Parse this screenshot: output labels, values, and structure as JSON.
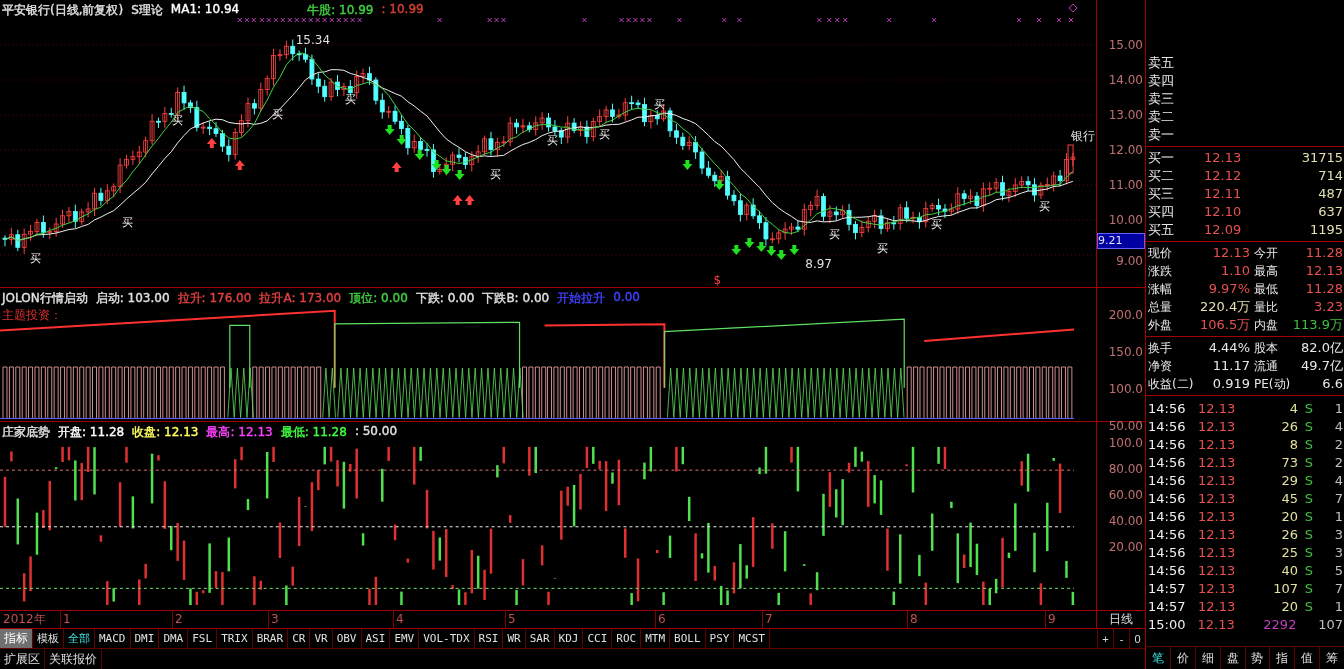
{
  "main_chart": {
    "header": [
      {
        "text": "平安银行(日线,前复权)",
        "color": "#e0e0e0"
      },
      {
        "text": "S理论",
        "color": "#e0e0e0"
      },
      {
        "text": "MA1: 10.94",
        "color": "#ffffff"
      },
      {
        "text": "牛股: 10.99",
        "color": "#40d040"
      },
      {
        "text": ": 10.99",
        "color": "#d04030"
      }
    ],
    "annotations": [
      {
        "kind": "high",
        "text": "15.34"
      },
      {
        "kind": "low",
        "text": "8.97"
      },
      {
        "kind": "name",
        "text": "银行"
      },
      {
        "kind": "signal",
        "text": "$"
      }
    ],
    "buy_labels": [
      "买",
      "买",
      "买",
      "买",
      "买",
      "买",
      "买",
      "买",
      "买",
      "买",
      "买",
      "买",
      "买"
    ],
    "axis": [
      "15.00",
      "14.00",
      "13.00",
      "12.00",
      "11.00",
      "10.00"
    ],
    "axis_last": "9.00",
    "current_price": "9.21"
  },
  "indicator_panel": {
    "header": [
      {
        "text": "JOLON行情启动",
        "color": "#e0e0e0"
      },
      {
        "text": "启动: 103.00",
        "color": "#e0e0e0"
      },
      {
        "text": "拉升: 176.00",
        "color": "#e04040"
      },
      {
        "text": "拉升A: 173.00",
        "color": "#e04040"
      },
      {
        "text": "顶位: 0.00",
        "color": "#40d040"
      },
      {
        "text": "下跌: 0.00",
        "color": "#e0e0e0"
      },
      {
        "text": "下跌B: 0.00",
        "color": "#e0e0e0"
      },
      {
        "text": "开始拉升",
        "color": "#4040ff"
      },
      {
        "text": "0.00",
        "color": "#4040ff"
      }
    ],
    "label": "主题投资：",
    "axis": [
      "200.0",
      "150.0",
      "100.0",
      "50.00"
    ]
  },
  "oscillator_panel": {
    "header": [
      {
        "text": "庄家底势",
        "color": "#e0e0e0"
      },
      {
        "text": "开盘: 11.28",
        "color": "#ffffff"
      },
      {
        "text": "收盘: 12.13",
        "color": "#ffff60"
      },
      {
        "text": "最高: 12.13",
        "color": "#ff40ff"
      },
      {
        "text": "最低: 11.28",
        "color": "#40ff40"
      },
      {
        "text": ": 50.00",
        "color": "#e0e0e0"
      }
    ],
    "axis": [
      "100.0",
      "80.00",
      "60.00",
      "40.00",
      "20.00"
    ]
  },
  "date_axis": {
    "year": "2012年",
    "months": [
      "1",
      "2",
      "3",
      "4",
      "5",
      "6",
      "7",
      "8",
      "9"
    ],
    "period": "日线"
  },
  "zoom_buttons": [
    "+",
    "-",
    "0"
  ],
  "indicator_tabs": [
    {
      "label": "指标",
      "selected": false,
      "kind": "header"
    },
    {
      "label": "模板",
      "selected": false,
      "kind": "item"
    },
    {
      "label": "全部",
      "selected": true,
      "kind": "item"
    },
    {
      "label": "MACD",
      "selected": false,
      "kind": "item"
    },
    {
      "label": "DMI",
      "selected": false,
      "kind": "item"
    },
    {
      "label": "DMA",
      "selected": false,
      "kind": "item"
    },
    {
      "label": "FSL",
      "selected": false,
      "kind": "item"
    },
    {
      "label": "TRIX",
      "selected": false,
      "kind": "item"
    },
    {
      "label": "BRAR",
      "selected": false,
      "kind": "item"
    },
    {
      "label": "CR",
      "selected": false,
      "kind": "item"
    },
    {
      "label": "VR",
      "selected": false,
      "kind": "item"
    },
    {
      "label": "OBV",
      "selected": false,
      "kind": "item"
    },
    {
      "label": "ASI",
      "selected": false,
      "kind": "item"
    },
    {
      "label": "EMV",
      "selected": false,
      "kind": "item"
    },
    {
      "label": "VOL-TDX",
      "selected": false,
      "kind": "item"
    },
    {
      "label": "RSI",
      "selected": false,
      "kind": "item"
    },
    {
      "label": "WR",
      "selected": false,
      "kind": "item"
    },
    {
      "label": "SAR",
      "selected": false,
      "kind": "item"
    },
    {
      "label": "KDJ",
      "selected": false,
      "kind": "item"
    },
    {
      "label": "CCI",
      "selected": false,
      "kind": "item"
    },
    {
      "label": "ROC",
      "selected": false,
      "kind": "item"
    },
    {
      "label": "MTM",
      "selected": false,
      "kind": "item"
    },
    {
      "label": "BOLL",
      "selected": false,
      "kind": "item"
    },
    {
      "label": "PSY",
      "selected": false,
      "kind": "item"
    },
    {
      "label": "MCST",
      "selected": false,
      "kind": "item"
    }
  ],
  "extension_tabs": [
    "扩展区",
    "关联报价"
  ],
  "quote": {
    "sell": [
      "卖五",
      "卖四",
      "卖三",
      "卖二",
      "卖一"
    ],
    "buy": [
      {
        "label": "买一",
        "price": "12.13",
        "volume": "31715"
      },
      {
        "label": "买二",
        "price": "12.12",
        "volume": "714"
      },
      {
        "label": "买三",
        "price": "12.11",
        "volume": "487"
      },
      {
        "label": "买四",
        "price": "12.10",
        "volume": "637"
      },
      {
        "label": "买五",
        "price": "12.09",
        "volume": "1195"
      }
    ],
    "stats": [
      {
        "cells": [
          {
            "label": "现价",
            "value": "12.13",
            "color": "#e85050"
          },
          {
            "label": "今开",
            "value": "11.28",
            "color": "#e85050"
          }
        ]
      },
      {
        "cells": [
          {
            "label": "涨跌",
            "value": "1.10",
            "color": "#e85050"
          },
          {
            "label": "最高",
            "value": "12.13",
            "color": "#e85050"
          }
        ]
      },
      {
        "cells": [
          {
            "label": "涨幅",
            "value": "9.97%",
            "color": "#e85050"
          },
          {
            "label": "最低",
            "value": "11.28",
            "color": "#e85050"
          }
        ]
      },
      {
        "cells": [
          {
            "label": "总量",
            "value": "220.4万",
            "color": "#e0e0b0"
          },
          {
            "label": "量比",
            "value": "3.23",
            "color": "#e85050"
          }
        ]
      },
      {
        "cells": [
          {
            "label": "外盘",
            "value": "106.5万",
            "color": "#e85050"
          },
          {
            "label": "内盘",
            "value": "113.9万",
            "color": "#40c040"
          }
        ]
      }
    ],
    "fundamentals": [
      {
        "label": "换手",
        "value": "4.44%",
        "label2": "股本",
        "value2": "82.0亿"
      },
      {
        "label": "净资",
        "value": "11.17",
        "label2": "流通",
        "value2": "49.7亿"
      },
      {
        "label": "收益(二)",
        "value": "0.919",
        "label2": "PE(动)",
        "value2": "6.6"
      }
    ],
    "trades": [
      {
        "kind": "trade",
        "time": "14:56",
        "price": "12.13",
        "volume": "4",
        "side": "S",
        "count": "1"
      },
      {
        "kind": "trade",
        "time": "14:56",
        "price": "12.13",
        "volume": "26",
        "side": "S",
        "count": "4"
      },
      {
        "kind": "trade",
        "time": "14:56",
        "price": "12.13",
        "volume": "8",
        "side": "S",
        "count": "2"
      },
      {
        "kind": "trade",
        "time": "14:56",
        "price": "12.13",
        "volume": "73",
        "side": "S",
        "count": "2"
      },
      {
        "kind": "trade",
        "time": "14:56",
        "price": "12.13",
        "volume": "29",
        "side": "S",
        "count": "4"
      },
      {
        "kind": "trade",
        "time": "14:56",
        "price": "12.13",
        "volume": "45",
        "side": "S",
        "count": "7"
      },
      {
        "kind": "trade",
        "time": "14:56",
        "price": "12.13",
        "volume": "20",
        "side": "S",
        "count": "1"
      },
      {
        "kind": "trade",
        "time": "14:56",
        "price": "12.13",
        "volume": "26",
        "side": "S",
        "count": "3"
      },
      {
        "kind": "trade",
        "time": "14:56",
        "price": "12.13",
        "volume": "25",
        "side": "S",
        "count": "3"
      },
      {
        "kind": "trade",
        "time": "14:56",
        "price": "12.13",
        "volume": "40",
        "side": "S",
        "count": "5"
      },
      {
        "kind": "trade",
        "time": "14:57",
        "price": "12.13",
        "volume": "107",
        "side": "S",
        "count": "7"
      },
      {
        "kind": "trade",
        "time": "14:57",
        "price": "12.13",
        "volume": "20",
        "side": "S",
        "count": "1"
      },
      {
        "kind": "summary",
        "time": "15:00",
        "price": "12.13",
        "volume": "2292",
        "count": "107"
      }
    ],
    "tabs": [
      {
        "label": "笔",
        "selected": true
      },
      {
        "label": "价",
        "selected": false
      },
      {
        "label": "细",
        "selected": false
      },
      {
        "label": "盘",
        "selected": false
      },
      {
        "label": "势",
        "selected": false
      },
      {
        "label": "指",
        "selected": false
      },
      {
        "label": "值",
        "selected": false
      },
      {
        "label": "筹",
        "selected": false
      }
    ]
  }
}
